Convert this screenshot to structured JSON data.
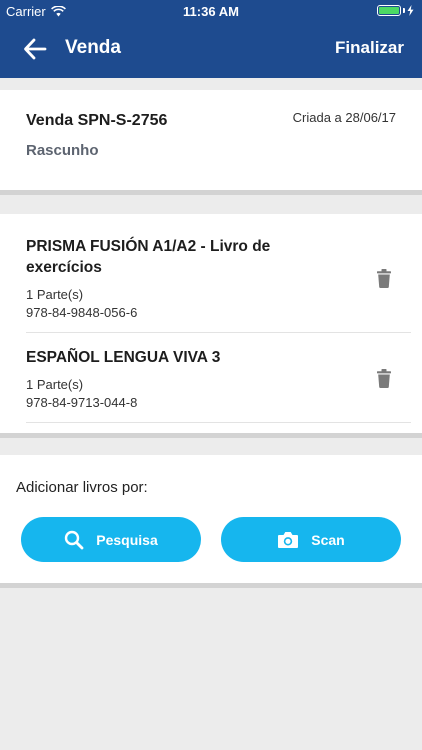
{
  "status_bar": {
    "carrier": "Carrier",
    "time": "11:36 AM",
    "battery_level": 1.0,
    "battery_color": "#4cd964"
  },
  "nav": {
    "title": "Venda",
    "action_label": "Finalizar",
    "back_icon": "arrow-left-icon",
    "background": "#1e4b8f"
  },
  "sale": {
    "id": "Venda SPN-S-2756",
    "created": "Criada a 28/06/17",
    "status": "Rascunho"
  },
  "books": [
    {
      "title": "PRISMA FUSIÓN A1/A2 - Livro de exercícios",
      "parts": "1 Parte(s)",
      "isbn": "978-84-9848-056-6"
    },
    {
      "title": "ESPAÑOL LENGUA VIVA 3",
      "parts": "1 Parte(s)",
      "isbn": "978-84-9713-044-8"
    }
  ],
  "add_books": {
    "label": "Adicionar livros por:",
    "search_label": "Pesquisa",
    "scan_label": "Scan",
    "accent": "#16b6ee"
  }
}
